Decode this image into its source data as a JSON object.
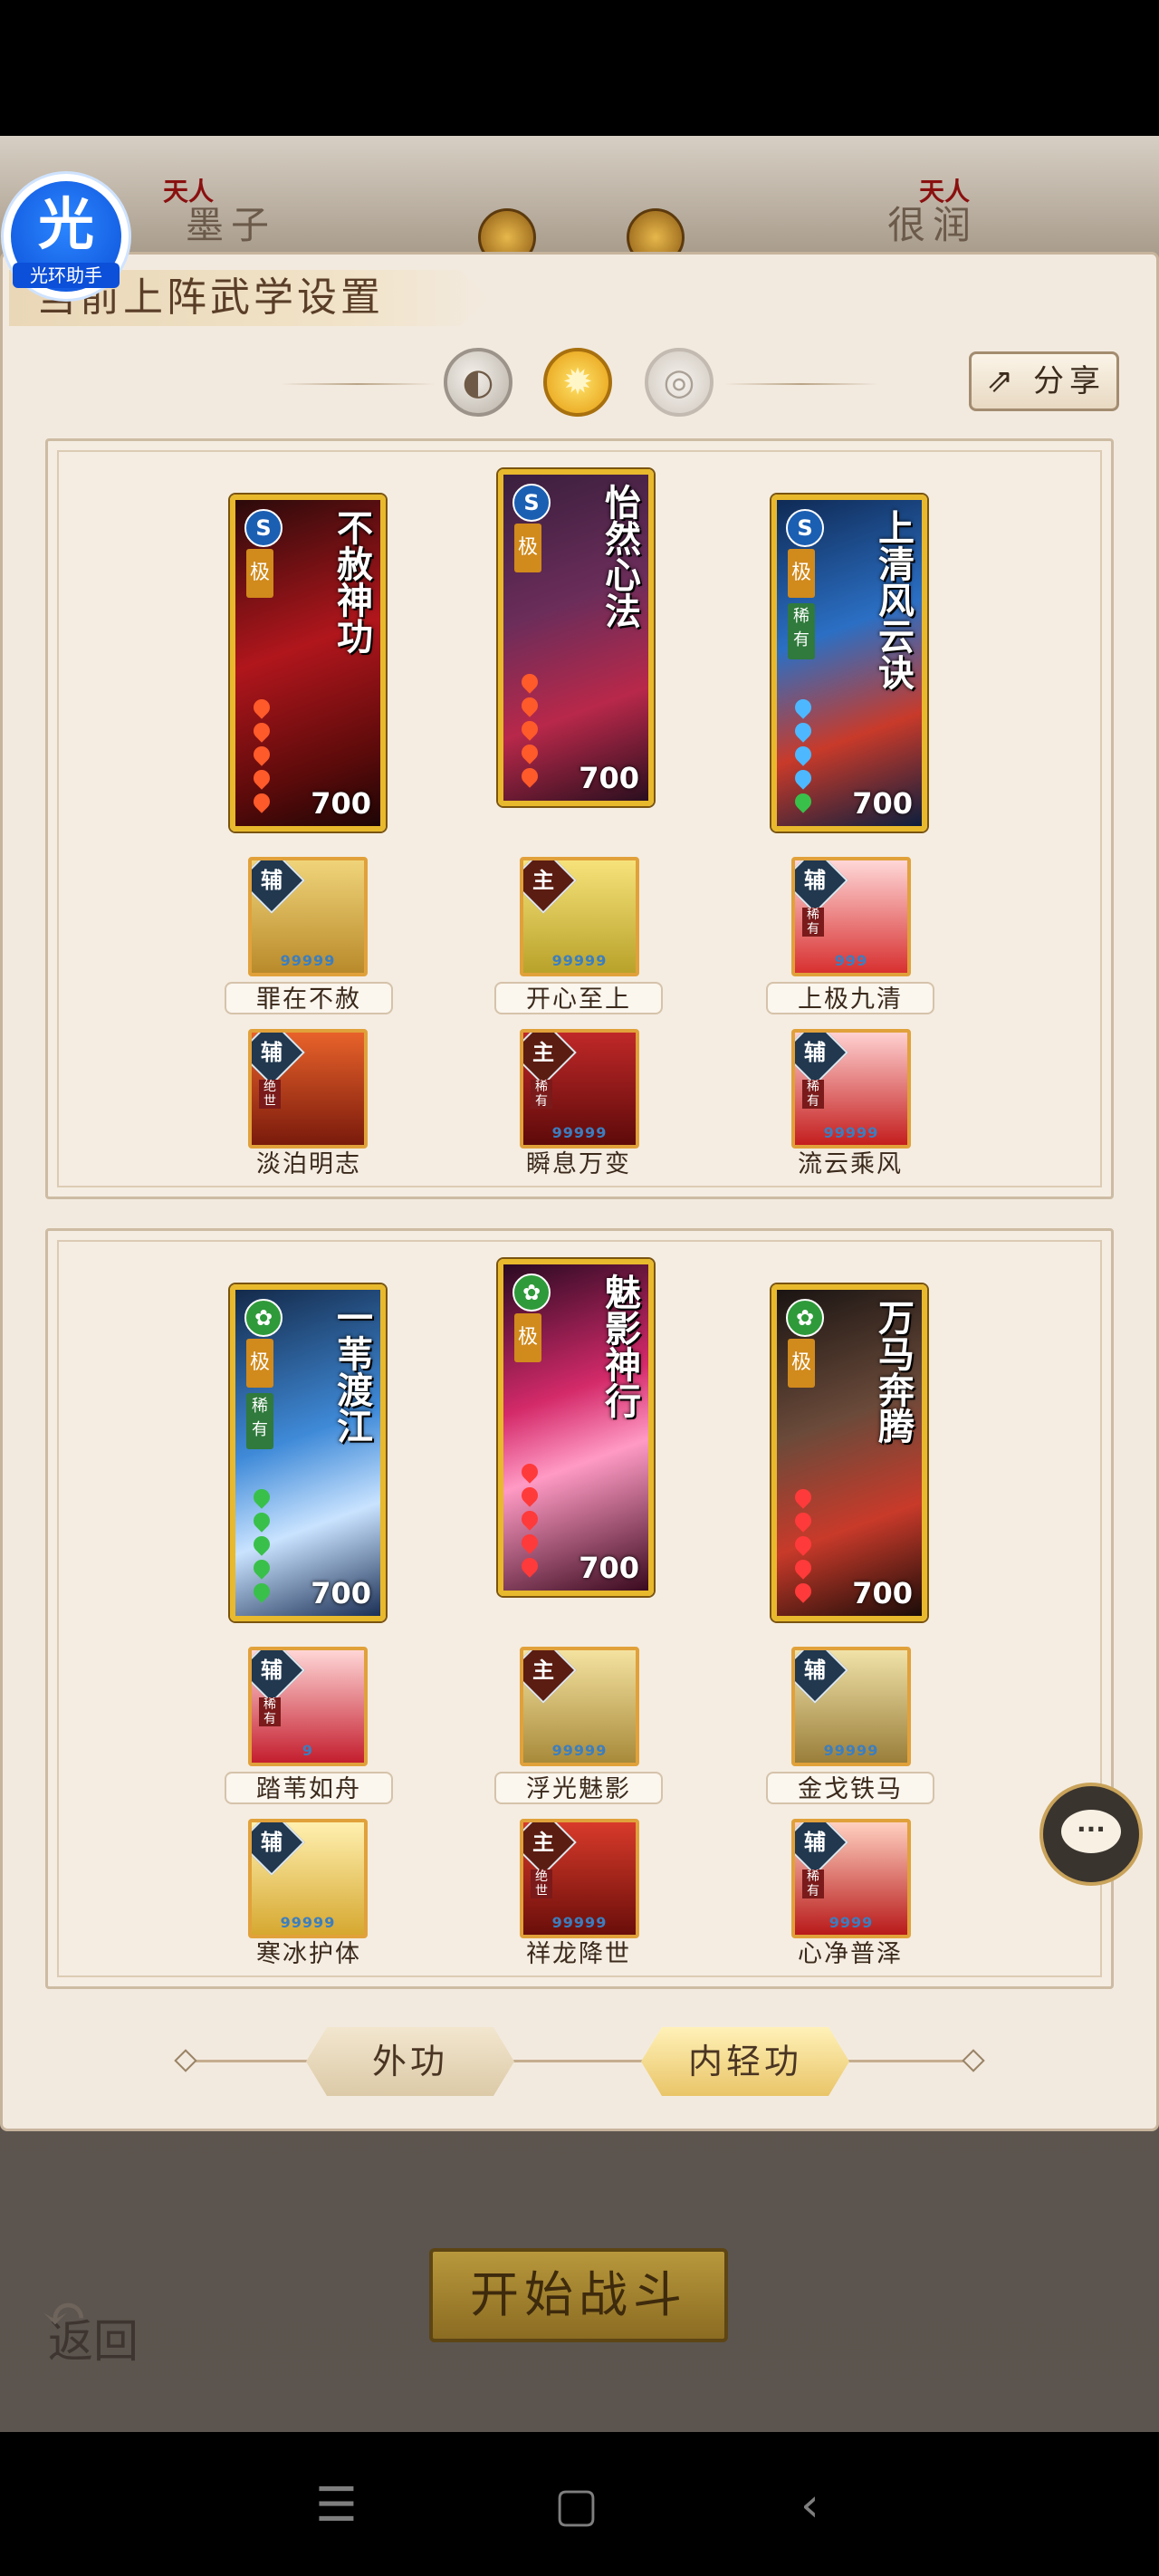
{
  "top_opponents": {
    "left_rank": "天人",
    "left_name": "墨子",
    "right_rank": "天人",
    "right_name": "很润"
  },
  "overlay_logo": {
    "glyph": "光",
    "caption": "光环助手"
  },
  "panel": {
    "title": "当前上阵武学设置",
    "share_label": "分享"
  },
  "mode_icons": [
    "moon-icon",
    "sun-icon",
    "ring-icon"
  ],
  "colors": {
    "card_gold": "#e8b92c",
    "panel_bg": "#f3eadf",
    "accent_blue": "#3b7ec0"
  },
  "section1": {
    "cards": [
      {
        "name": "不赦神功",
        "grade": "极",
        "power": "700",
        "type": "S"
      },
      {
        "name": "怡然心法",
        "grade": "极",
        "power": "700",
        "type": "S"
      },
      {
        "name": "上清风云诀",
        "grade": "极",
        "rarity": "稀有",
        "power": "700",
        "type": "S"
      }
    ],
    "skills_row1": [
      {
        "role": "辅",
        "label": "罪在不赦",
        "stars": "99999"
      },
      {
        "role": "主",
        "label": "开心至上",
        "stars": "99999"
      },
      {
        "role": "辅",
        "label": "上极九清",
        "tag": "稀有",
        "stars": "999"
      }
    ],
    "skills_row2": [
      {
        "role": "辅",
        "label": "淡泊明志",
        "tag": "绝世"
      },
      {
        "role": "主",
        "label": "瞬息万变",
        "tag": "稀有",
        "stars": "99999"
      },
      {
        "role": "辅",
        "label": "流云乘风",
        "tag": "稀有",
        "stars": "99999"
      }
    ]
  },
  "section2": {
    "cards": [
      {
        "name": "一苇渡江",
        "grade": "极",
        "rarity": "稀有",
        "power": "700"
      },
      {
        "name": "魅影神行",
        "grade": "极",
        "power": "700"
      },
      {
        "name": "万马奔腾",
        "grade": "极",
        "power": "700"
      }
    ],
    "skills_row1": [
      {
        "role": "辅",
        "label": "踏苇如舟",
        "tag": "稀有",
        "stars": "9"
      },
      {
        "role": "主",
        "label": "浮光魅影",
        "stars": "99999"
      },
      {
        "role": "辅",
        "label": "金戈铁马",
        "stars": "99999"
      }
    ],
    "skills_row2": [
      {
        "role": "辅",
        "label": "寒冰护体",
        "stars": "99999"
      },
      {
        "role": "主",
        "label": "祥龙降世",
        "tag": "绝世",
        "stars": "99999"
      },
      {
        "role": "辅",
        "label": "心净普泽",
        "tag": "稀有",
        "stars": "9999"
      }
    ]
  },
  "tabs": {
    "outer": "外功",
    "inner": "内轻功"
  },
  "buttons": {
    "start": "开始战斗",
    "back": "返回"
  },
  "android_nav": [
    "menu-icon",
    "home-icon",
    "back-icon"
  ]
}
